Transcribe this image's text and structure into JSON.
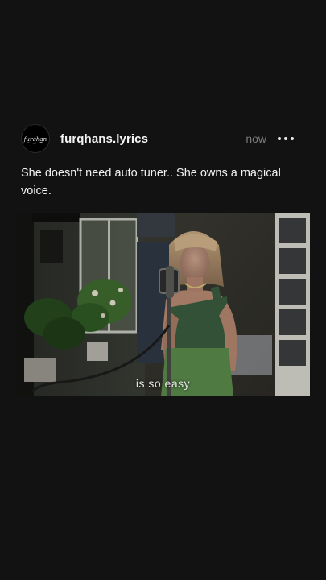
{
  "post": {
    "username": "furqhans.lyrics",
    "avatar_text": "furqhan",
    "timestamp": "now",
    "more_icon": "more-horizontal-icon",
    "caption": "She doesn't need auto tuner.. She owns a magical voice.",
    "media": {
      "subtitle": "is so easy"
    }
  },
  "colors": {
    "background": "#121212",
    "text": "#f2f2f2",
    "muted": "#7a7a7a"
  }
}
